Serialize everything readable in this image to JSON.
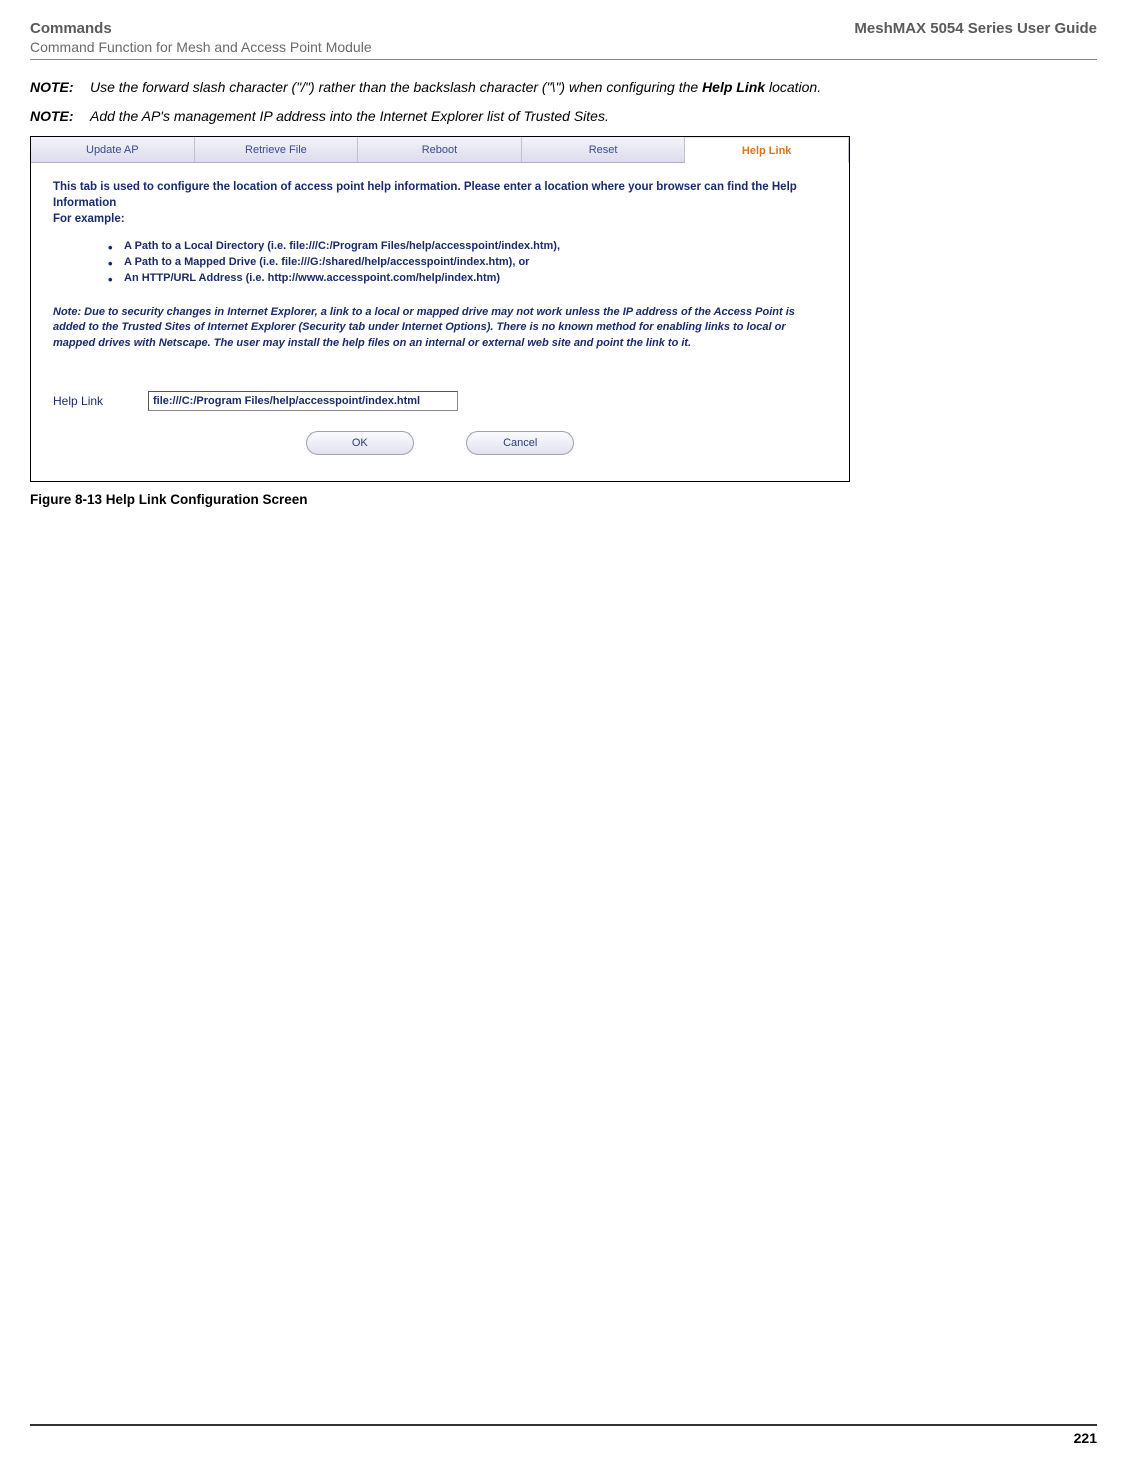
{
  "header": {
    "left": "Commands",
    "right": "MeshMAX 5054 Series User Guide",
    "sub": "Command Function for Mesh and Access Point Module"
  },
  "notes": {
    "label": "NOTE:",
    "note1_prefix": "Use the forward slash character (\"/\") rather than the backslash character (\"\\\") when configuring the ",
    "note1_bold": "Help Link",
    "note1_suffix": " location.",
    "note2": "Add the AP's management IP address into the Internet Explorer list of Trusted Sites."
  },
  "tabs": {
    "t1": "Update AP",
    "t2": "Retrieve File",
    "t3": "Reboot",
    "t4": "Reset",
    "t5": "Help Link"
  },
  "panel": {
    "intro": "This tab is used to configure the location of access point help information. Please enter a location where your browser can find the Help Information",
    "forExample": "For example:",
    "bullets": {
      "b1": "A Path to a Local Directory (i.e. file:///C:/Program Files/help/accesspoint/index.htm),",
      "b2": "A Path to a Mapped Drive (i.e. file:///G:/shared/help/accesspoint/index.htm), or",
      "b3": "An HTTP/URL Address (i.e. http://www.accesspoint.com/help/index.htm)"
    },
    "noteText": "Note: Due to security changes in Internet Explorer, a link to a local or mapped drive may not work unless the IP address of the Access Point is added to the Trusted Sites of Internet Explorer (Security tab under Internet Options). There is no known method for enabling links to local or mapped drives with Netscape. The user may install the help files on an internal or external web site and point the link to it.",
    "fieldLabel": "Help Link",
    "fieldValue": "file:///C:/Program Files/help/accesspoint/index.html",
    "okLabel": "OK",
    "cancelLabel": "Cancel"
  },
  "figure": {
    "caption": "Figure 8-13 Help Link Configuration Screen"
  },
  "footer": {
    "pageNum": "221"
  }
}
